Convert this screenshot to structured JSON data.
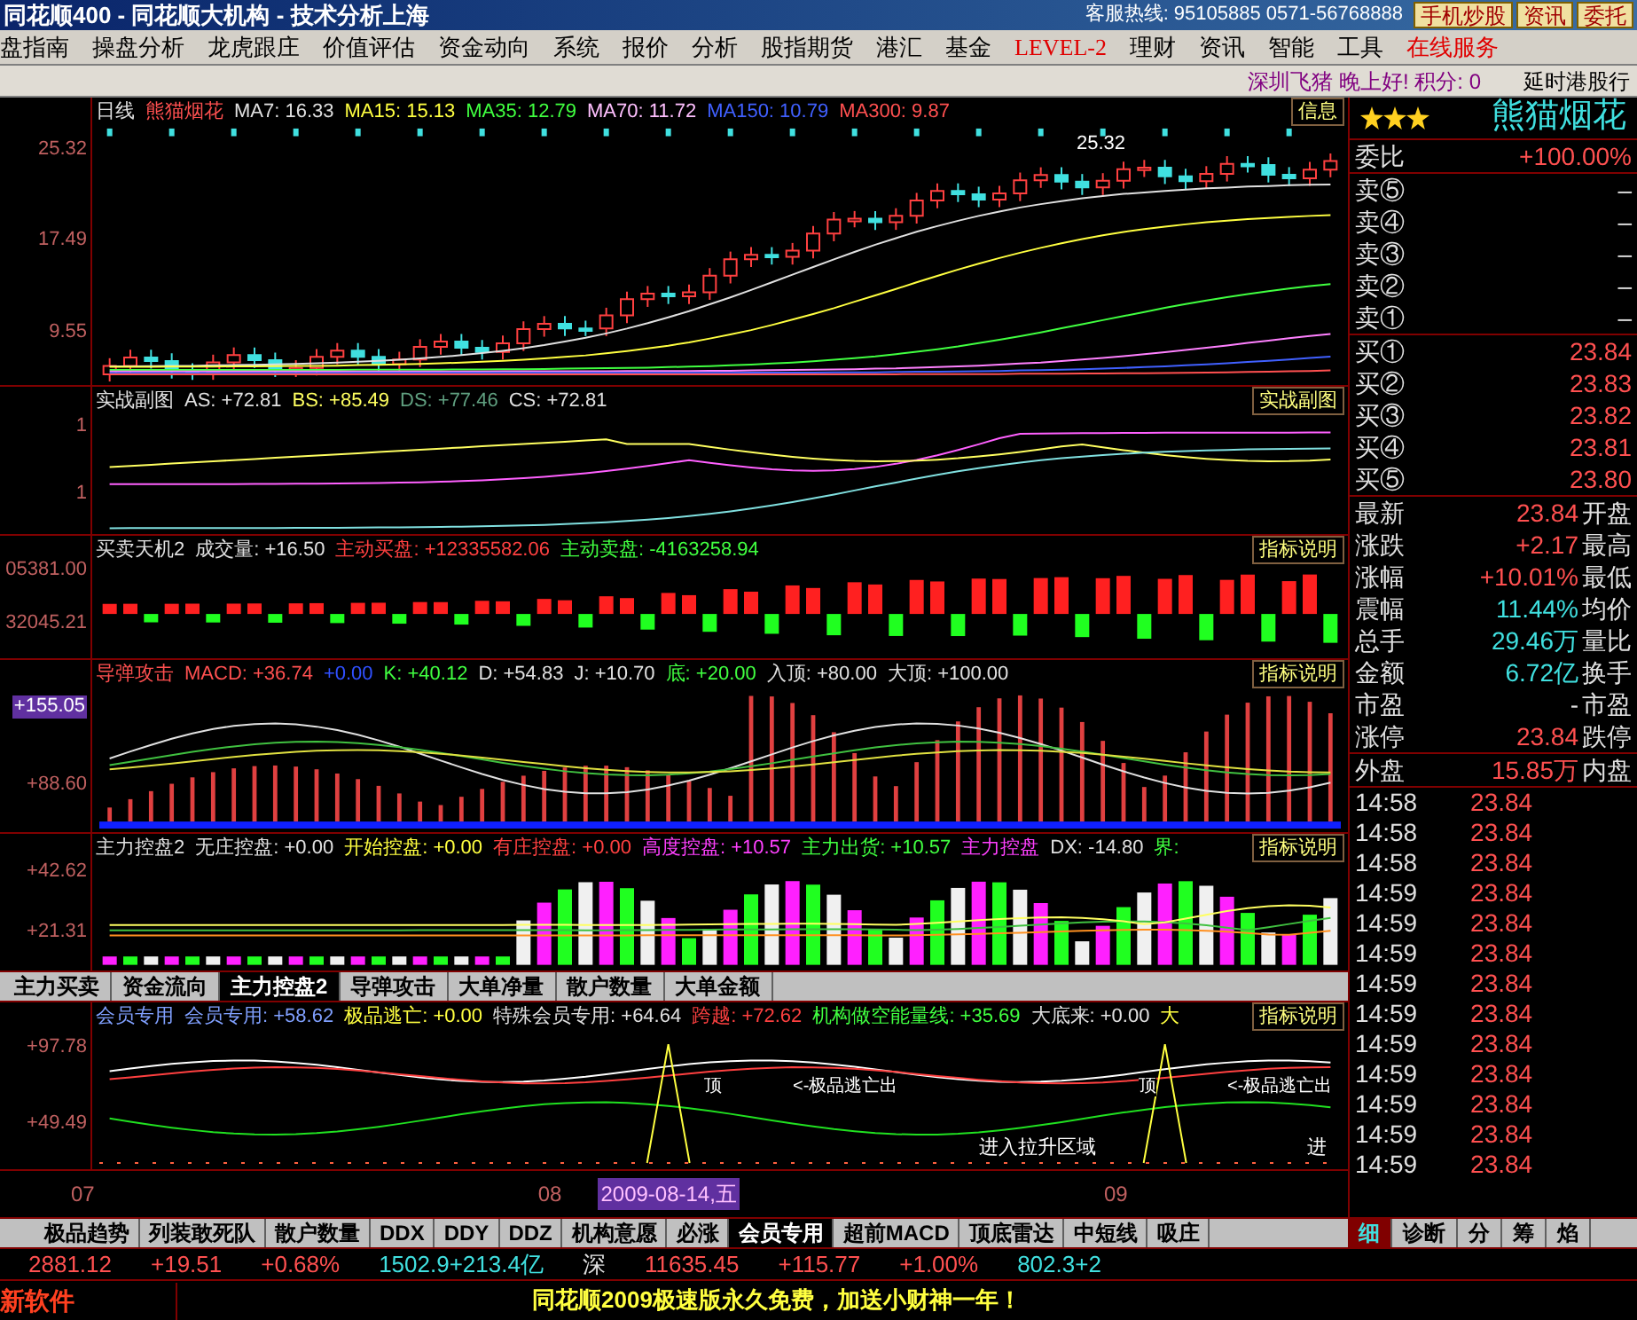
{
  "title_bar": {
    "title": "同花顺400 - 同花顺大机构 - 技术分析上海",
    "hotline": "客服热线: 95105885  0571-56768888",
    "buttons": [
      "手机炒股",
      "资讯",
      "委托"
    ]
  },
  "menu": [
    {
      "label": "盘指南",
      "kind": "normal"
    },
    {
      "label": "操盘分析",
      "kind": "normal"
    },
    {
      "label": "龙虎跟庄",
      "kind": "normal"
    },
    {
      "label": "价值评估",
      "kind": "normal"
    },
    {
      "label": "资金动向",
      "kind": "normal"
    },
    {
      "label": "系统",
      "kind": "normal"
    },
    {
      "label": "报价",
      "kind": "normal"
    },
    {
      "label": "分析",
      "kind": "normal"
    },
    {
      "label": "股指期货",
      "kind": "normal"
    },
    {
      "label": "港汇",
      "kind": "normal"
    },
    {
      "label": "基金",
      "kind": "normal"
    },
    {
      "label": "LEVEL-2",
      "kind": "highlight"
    },
    {
      "label": "理财",
      "kind": "normal"
    },
    {
      "label": "资讯",
      "kind": "normal"
    },
    {
      "label": "智能",
      "kind": "normal"
    },
    {
      "label": "工具",
      "kind": "normal"
    },
    {
      "label": "在线服务",
      "kind": "highlight"
    }
  ],
  "sub_bar": {
    "greeting": "深圳飞猪 晚上好! 积分: 0",
    "right": "延时港股行"
  },
  "panels": [
    {
      "kind": "candles",
      "values": [
        {
          "text": "日线",
          "color": "#e0e0e0"
        },
        {
          "text": "熊猫烟花",
          "color": "#ff5050"
        },
        {
          "text": "MA7: 16.33",
          "color": "#e0e0e0"
        },
        {
          "text": "MA15: 15.13",
          "color": "#ffff40"
        },
        {
          "text": "MA35: 12.79",
          "color": "#40ff40"
        },
        {
          "text": "MA70: 11.72",
          "color": "#ffc0ff"
        },
        {
          "text": "MA150: 10.79",
          "color": "#4060ff"
        },
        {
          "text": "MA300: 9.87",
          "color": "#ff5050"
        }
      ],
      "button": "信息",
      "y_labels": [
        "25.32",
        "17.49",
        "9.55"
      ],
      "annotation": "25.32"
    },
    {
      "kind": "lines",
      "values": [
        {
          "text": "实战副图",
          "color": "#e0e0e0"
        },
        {
          "text": "AS: +72.81",
          "color": "#e0e0e0"
        },
        {
          "text": "BS: +85.49",
          "color": "#ffff60"
        },
        {
          "text": "DS: +77.46",
          "color": "#60a080"
        },
        {
          "text": "CS: +72.81",
          "color": "#e0e0e0"
        }
      ],
      "button": "实战副图",
      "y_labels": [
        "1",
        "1"
      ]
    },
    {
      "kind": "volume",
      "values": [
        {
          "text": "买卖天机2",
          "color": "#e0e0e0"
        },
        {
          "text": "成交量: +16.50",
          "color": "#e0e0e0"
        },
        {
          "text": "主动买盘: +12335582.06",
          "color": "#ff4040"
        },
        {
          "text": "主动卖盘: -4163258.94",
          "color": "#40ff40"
        }
      ],
      "button": "指标说明",
      "y_labels": [
        "05381.00",
        "32045.21"
      ]
    },
    {
      "kind": "missile",
      "values": [
        {
          "text": "导弹攻击",
          "color": "#ff5050"
        },
        {
          "text": "MACD: +36.74",
          "color": "#ff5050"
        },
        {
          "text": "+0.00",
          "color": "#3050ff"
        },
        {
          "text": "K: +40.12",
          "color": "#40ff40"
        },
        {
          "text": "D: +54.83",
          "color": "#e0e0e0"
        },
        {
          "text": "J: +10.70",
          "color": "#e0e0e0"
        },
        {
          "text": "底: +20.00",
          "color": "#40ff40"
        },
        {
          "text": "入顶: +80.00",
          "color": "#e0e0e0"
        },
        {
          "text": "大顶: +100.00",
          "color": "#e0e0e0"
        }
      ],
      "button": "指标说明",
      "y_labels": [
        "+88.60"
      ],
      "cursor_label": "+155.05"
    },
    {
      "kind": "control",
      "values": [
        {
          "text": "主力控盘2",
          "color": "#e0e0e0"
        },
        {
          "text": "无庄控盘: +0.00",
          "color": "#e0e0e0"
        },
        {
          "text": "开始控盘: +0.00",
          "color": "#ffff40"
        },
        {
          "text": "有庄控盘: +0.00",
          "color": "#ff4040"
        },
        {
          "text": "高度控盘: +10.57",
          "color": "#ff40ff"
        },
        {
          "text": "主力出货: +10.57",
          "color": "#40ff40"
        },
        {
          "text": "主力控盘",
          "color": "#ff40ff"
        },
        {
          "text": "DX: -14.80",
          "color": "#e0e0e0"
        },
        {
          "text": "界:",
          "color": "#40ff40"
        }
      ],
      "button": "指标说明",
      "y_labels": [
        "+42.62",
        "+21.31"
      ]
    },
    {
      "kind": "tabs",
      "tabs": [
        {
          "label": "主力买卖",
          "selected": false
        },
        {
          "label": "资金流向",
          "selected": false
        },
        {
          "label": "主力控盘2",
          "selected": true
        },
        {
          "label": "导弹攻击",
          "selected": false
        },
        {
          "label": "大单净量",
          "selected": false
        },
        {
          "label": "散户数量",
          "selected": false
        },
        {
          "label": "大单金额",
          "selected": false
        }
      ]
    },
    {
      "kind": "member",
      "values": [
        {
          "text": "会员专用",
          "color": "#80a0ff"
        },
        {
          "text": "会员专用: +58.62",
          "color": "#80a0ff"
        },
        {
          "text": "极品逃亡: +0.00",
          "color": "#ffff40"
        },
        {
          "text": "特殊会员专用: +64.64",
          "color": "#e0e0e0"
        },
        {
          "text": "跨越: +72.62",
          "color": "#ff4040"
        },
        {
          "text": "机构做空能量线: +35.69",
          "color": "#40ff40"
        },
        {
          "text": "大底来: +0.00",
          "color": "#e0e0e0"
        },
        {
          "text": "大",
          "color": "#ffff40"
        }
      ],
      "button": "指标说明",
      "y_labels": [
        "+97.78",
        "+49.49"
      ],
      "marks": [
        "顶",
        "<-极品逃亡出",
        "顶",
        "<-极品逃亡出"
      ],
      "notes": [
        "进入拉升区域",
        "进"
      ]
    }
  ],
  "x_axis": [
    {
      "text": "07",
      "selected": false
    },
    {
      "text": "08",
      "selected": false
    },
    {
      "text": "2009-08-14,五",
      "selected": true
    },
    {
      "text": "09",
      "selected": false
    }
  ],
  "bottom_tabs": [
    {
      "label": "极品趋势",
      "selected": false
    },
    {
      "label": "列装敢死队",
      "selected": false
    },
    {
      "label": "散户数量",
      "selected": false
    },
    {
      "label": "DDX",
      "selected": false
    },
    {
      "label": "DDY",
      "selected": false
    },
    {
      "label": "DDZ",
      "selected": false
    },
    {
      "label": "机构意愿",
      "selected": false
    },
    {
      "label": "必涨",
      "selected": false
    },
    {
      "label": "会员专用",
      "selected": true
    },
    {
      "label": "超前MACD",
      "selected": false
    },
    {
      "label": "顶底雷达",
      "selected": false
    },
    {
      "label": "中短线",
      "selected": false
    },
    {
      "label": "吸庄",
      "selected": false
    }
  ],
  "quote": {
    "stars": 3,
    "name": "熊猫烟花",
    "wei_bi": {
      "label": "委比",
      "value": "+100.00%"
    },
    "asks": [
      {
        "label": "卖⑤",
        "value": "–"
      },
      {
        "label": "卖④",
        "value": "–"
      },
      {
        "label": "卖③",
        "value": "–"
      },
      {
        "label": "卖②",
        "value": "–"
      },
      {
        "label": "卖①",
        "value": "–"
      }
    ],
    "bids": [
      {
        "label": "买①",
        "value": "23.84"
      },
      {
        "label": "买②",
        "value": "23.83"
      },
      {
        "label": "买③",
        "value": "23.82"
      },
      {
        "label": "买④",
        "value": "23.81"
      },
      {
        "label": "买⑤",
        "value": "23.80"
      }
    ],
    "stats": [
      {
        "label": "最新",
        "value": "23.84",
        "color": "#ff5050",
        "right": "开盘"
      },
      {
        "label": "涨跌",
        "value": "+2.17",
        "color": "#ff5050",
        "right": "最高"
      },
      {
        "label": "涨幅",
        "value": "+10.01%",
        "color": "#ff5050",
        "right": "最低"
      },
      {
        "label": "震幅",
        "value": "11.44%",
        "color": "#40e0e0",
        "right": "均价"
      },
      {
        "label": "总手",
        "value": "29.46万",
        "color": "#40e0e0",
        "right": "量比"
      },
      {
        "label": "金额",
        "value": "6.72亿",
        "color": "#40e0e0",
        "right": "换手"
      },
      {
        "label": "市盈",
        "value": "-",
        "color": "#e0e0e0",
        "right": "市盈"
      },
      {
        "label": "涨停",
        "value": "23.84",
        "color": "#ff5050",
        "right": "跌停"
      }
    ],
    "outer": {
      "label": "外盘",
      "value": "15.85万",
      "right": "内盘"
    },
    "ticks": [
      {
        "time": "14:58",
        "price": "23.84"
      },
      {
        "time": "14:58",
        "price": "23.84"
      },
      {
        "time": "14:58",
        "price": "23.84"
      },
      {
        "time": "14:59",
        "price": "23.84"
      },
      {
        "time": "14:59",
        "price": "23.84"
      },
      {
        "time": "14:59",
        "price": "23.84"
      },
      {
        "time": "14:59",
        "price": "23.84"
      },
      {
        "time": "14:59",
        "price": "23.84"
      },
      {
        "time": "14:59",
        "price": "23.84"
      },
      {
        "time": "14:59",
        "price": "23.84"
      },
      {
        "time": "14:59",
        "price": "23.84"
      },
      {
        "time": "14:59",
        "price": "23.84"
      },
      {
        "time": "14:59",
        "price": "23.84"
      }
    ],
    "tabs": [
      {
        "label": "细",
        "selected": true
      },
      {
        "label": "诊断",
        "selected": false
      },
      {
        "label": "分",
        "selected": false
      },
      {
        "label": "筹",
        "selected": false
      },
      {
        "label": "焰",
        "selected": false
      }
    ]
  },
  "index_bar": [
    {
      "text": "2881.12",
      "color": "#ff5050"
    },
    {
      "text": "+19.51",
      "color": "#ff5050"
    },
    {
      "text": "+0.68%",
      "color": "#ff5050"
    },
    {
      "text": "1502.9+213.4亿",
      "color": "#40e0e0"
    },
    {
      "text": "深",
      "color": "#e0e0e0"
    },
    {
      "text": "11635.45",
      "color": "#ff5050"
    },
    {
      "text": "+115.77",
      "color": "#ff5050"
    },
    {
      "text": "+1.00%",
      "color": "#ff5050"
    },
    {
      "text": "802.3+2",
      "color": "#40e0e0"
    }
  ],
  "ticker": {
    "left": "新软件",
    "message": "同花顺2009极速版永久免费，加送小财神一年！"
  }
}
